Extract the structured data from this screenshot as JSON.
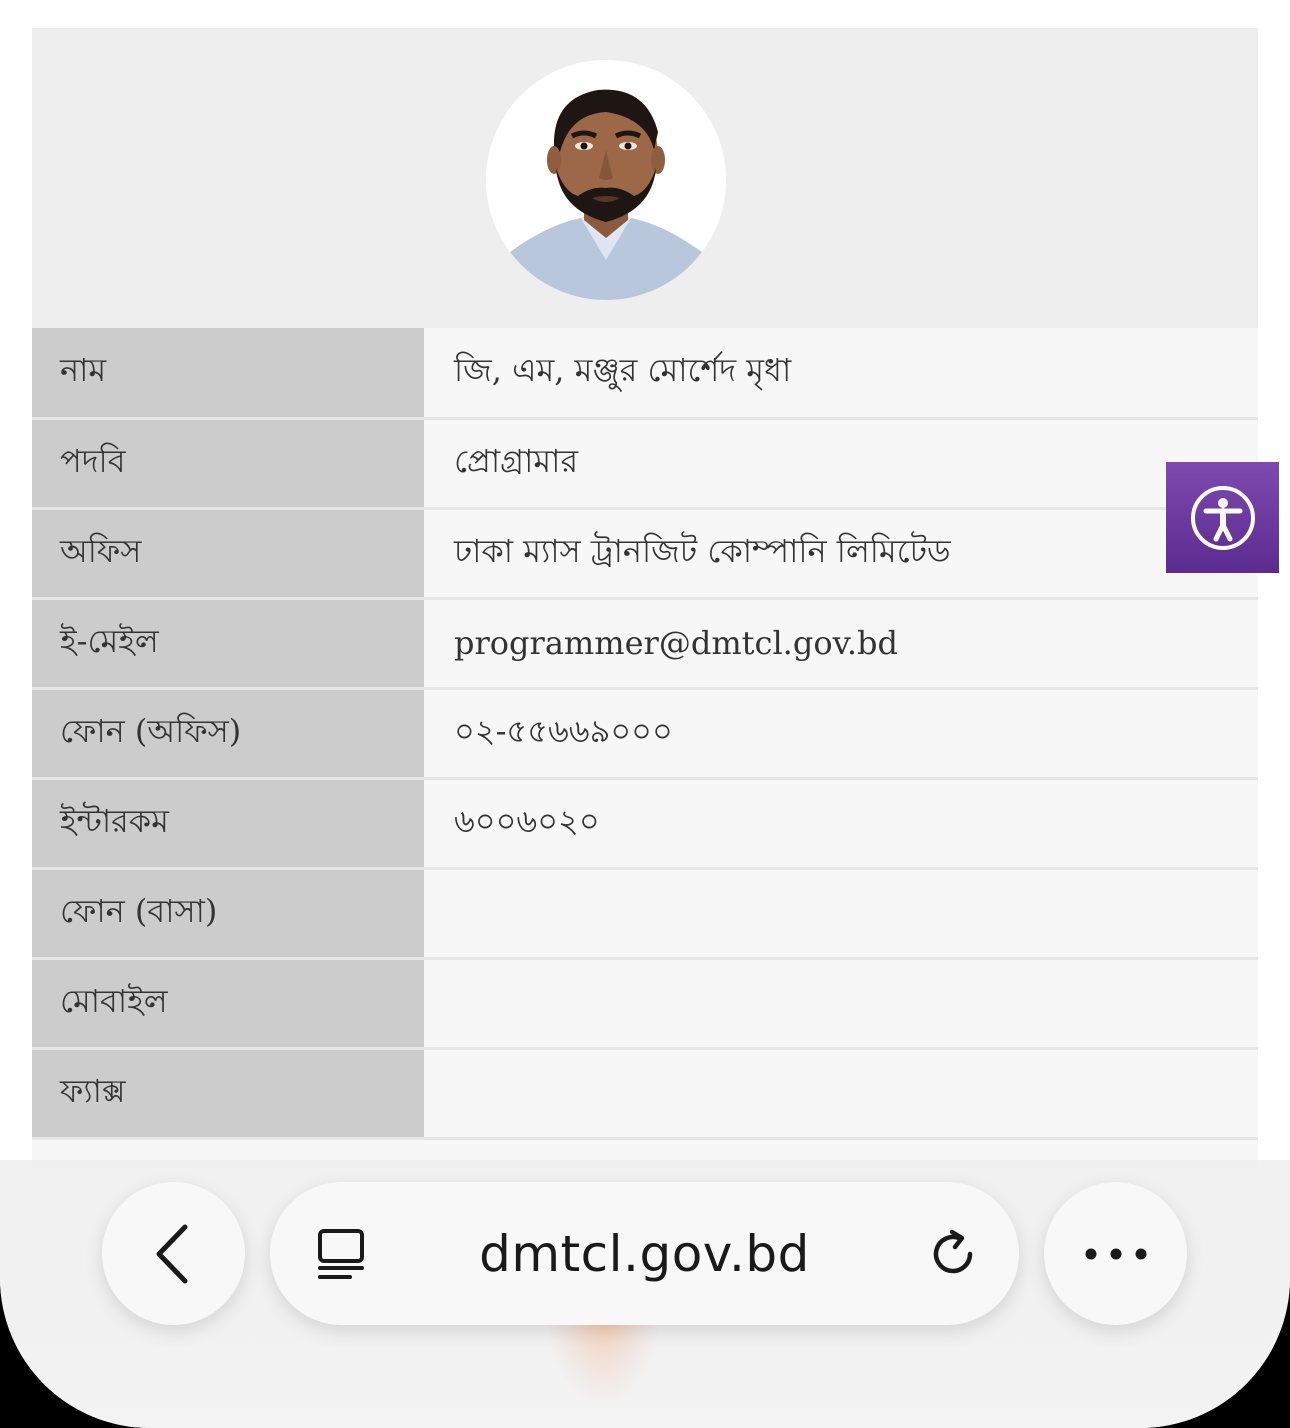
{
  "profile": {
    "rows": [
      {
        "label": "নাম",
        "value": "জি, এম, মঞ্জুর মোর্শেদ মৃধা"
      },
      {
        "label": "পদবি",
        "value": "প্রোগ্রামার"
      },
      {
        "label": "অফিস",
        "value": "ঢাকা ম্যাস ট্রানজিট কোম্পানি লিমিটেড"
      },
      {
        "label": "ই-মেইল",
        "value": "programmer@dmtcl.gov.bd"
      },
      {
        "label": "ফোন (অফিস)",
        "value": "০২-৫৫৬৬৯০০০"
      },
      {
        "label": "ইন্টারকম",
        "value": "৬০০৬০২০"
      },
      {
        "label": "ফোন (বাসা)",
        "value": ""
      },
      {
        "label": "মোবাইল",
        "value": ""
      },
      {
        "label": "ফ্যাক্স",
        "value": ""
      }
    ]
  },
  "browser": {
    "url": "dmtcl.gov.bd",
    "icons": {
      "back": "chevron-left-icon",
      "tabs": "tabs-icon",
      "reload": "reload-icon",
      "more": "more-horizontal-icon"
    }
  },
  "accessibility": {
    "icon": "accessibility-icon",
    "color": "#6a3aa0"
  }
}
